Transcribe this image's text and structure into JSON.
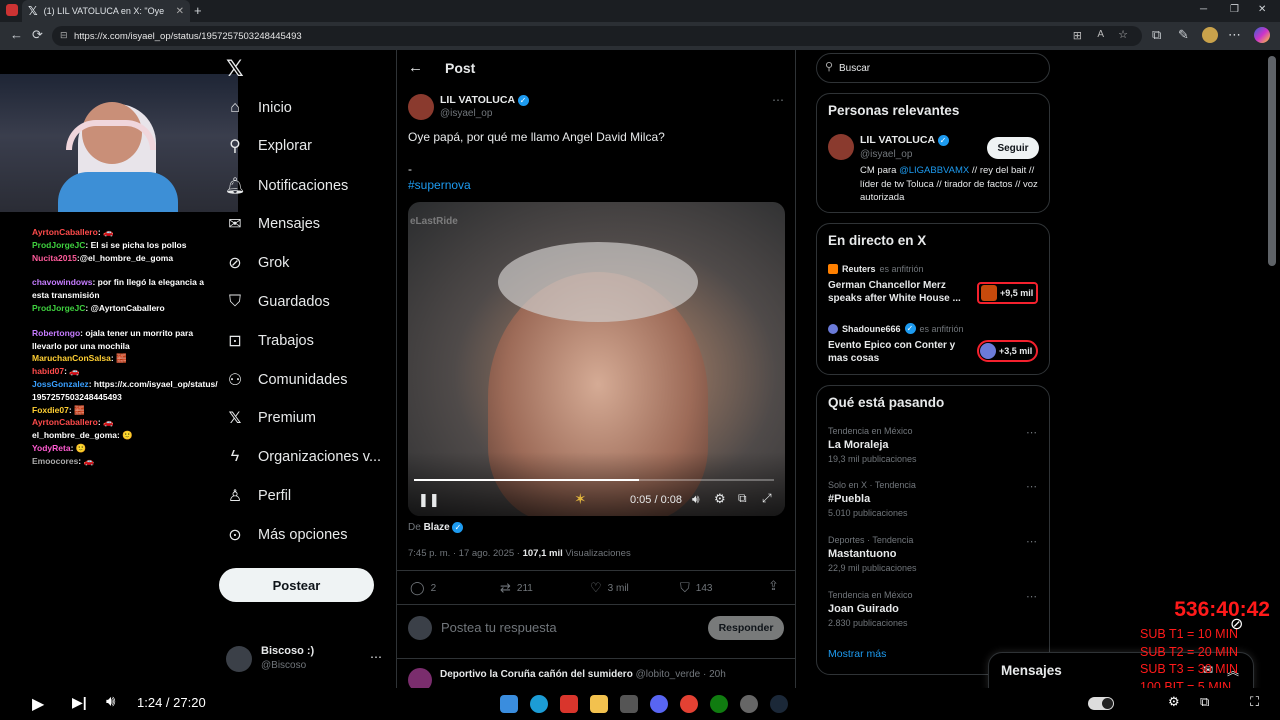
{
  "browser": {
    "tab_title": "(1) LIL VATOLUCA en X: \"Oye",
    "url": "https://x.com/isyael_op/status/1957257503248445493"
  },
  "nav": {
    "items": [
      {
        "label": "Inicio",
        "icon": "home-icon"
      },
      {
        "label": "Explorar",
        "icon": "search-icon"
      },
      {
        "label": "Notificaciones",
        "icon": "bell-icon"
      },
      {
        "label": "Mensajes",
        "icon": "mail-icon"
      },
      {
        "label": "Grok",
        "icon": "grok-icon"
      },
      {
        "label": "Guardados",
        "icon": "bookmark-icon"
      },
      {
        "label": "Trabajos",
        "icon": "briefcase-icon"
      },
      {
        "label": "Comunidades",
        "icon": "people-icon"
      },
      {
        "label": "Premium",
        "icon": "x-icon"
      },
      {
        "label": "Organizaciones v...",
        "icon": "lightning-icon"
      },
      {
        "label": "Perfil",
        "icon": "person-icon"
      },
      {
        "label": "Más opciones",
        "icon": "more-circle-icon"
      }
    ],
    "post_button": "Postear",
    "account_name": "Biscoso :)",
    "account_handle": "@Biscoso"
  },
  "post": {
    "header": "Post",
    "author_name": "LIL VATOLUCA",
    "author_handle": "@isyael_op",
    "text": "Oye papá, por qué me llamo Angel David Milca?",
    "text_line2": "-",
    "hashtag": "#supernova",
    "video_watermark": "eLastRide",
    "video_time": "0:05 / 0:08",
    "video_progress": 0.625,
    "source_prefix": "De",
    "source": "Blaze",
    "timestamp": "7:45 p. m. · 17 ago. 2025 · ",
    "views_count": "107,1 mil",
    "views_label": "Visualizaciones",
    "replies": "2",
    "reposts": "211",
    "likes": "3 mil",
    "bookmarks": "143",
    "reply_placeholder": "Postea tu respuesta",
    "reply_button": "Responder",
    "next_author": "Deportivo la Coruña cañón del sumidero",
    "next_handle": "@lobito_verde · 20h"
  },
  "search": {
    "placeholder": "Buscar"
  },
  "relevant": {
    "title": "Personas relevantes",
    "name": "LIL VATOLUCA",
    "handle": "@isyael_op",
    "follow": "Seguir",
    "bio_prefix": "CM para ",
    "bio_mention": "@LIGABBVAMX",
    "bio_rest": " // rey del bait // líder de tw Toluca // tirador de factos // voz autorizada"
  },
  "live": {
    "title": "En directo en X",
    "items": [
      {
        "host": "Reuters",
        "role": "es anfitrión",
        "title": "German Chancellor Merz speaks after White House ...",
        "count": "+9,5 mil"
      },
      {
        "host": "Shadoune666",
        "role": "es anfitrión",
        "title": "Evento Epico con Conter y mas cosas",
        "count": "+3,5 mil"
      }
    ]
  },
  "trends": {
    "title": "Qué está pasando",
    "items": [
      {
        "cat": "Tendencia en México",
        "name": "La Moraleja",
        "count": "19,3 mil publicaciones"
      },
      {
        "cat": "Solo en X · Tendencia",
        "name": "#Puebla",
        "count": "5.010 publicaciones"
      },
      {
        "cat": "Deportes · Tendencia",
        "name": "Mastantuono",
        "count": "22,9 mil publicaciones"
      },
      {
        "cat": "Tendencia en México",
        "name": "Joan Guirado",
        "count": "2.830 publicaciones"
      }
    ],
    "more": "Mostrar más"
  },
  "messages_drawer": "Mensajes",
  "stream": {
    "timer": "536:40:42",
    "subs": [
      "SUB T1 = 10 MIN",
      "SUB T2 = 20 MIN",
      "SUB T3 = 30 MIN",
      "100 BIT = 5 MIN"
    ],
    "chat": [
      {
        "user": "AyrtonCaballero",
        "color": "#ff4b4b",
        "msg": ""
      },
      {
        "user": "ProdJorgeJC",
        "color": "#3fd13f",
        "msg": "El si se picha los pollos"
      },
      {
        "user": "Nucita2015",
        "color": "#ff5b9b",
        "msg": "@el_hombre_de_goma"
      },
      {
        "user": "chavowindows",
        "color": "#c67cff",
        "msg": "por fin llegó la elegancia a esta transmisión"
      },
      {
        "user": "ProdJorgeJC",
        "color": "#3fd13f",
        "msg": "@AyrtonCaballero"
      },
      {
        "user": "Robertongo",
        "color": "#c67cff",
        "msg": "ojala tener un morrito para llevarlo por una mochila"
      },
      {
        "user": "MaruchanConSalsa",
        "color": "#ffcf33",
        "msg": ""
      },
      {
        "user": "habid07",
        "color": "#ff4b4b",
        "msg": ""
      },
      {
        "user": "JossGonzalez",
        "color": "#3aa0ff",
        "msg": "https://x.com/isyael_op/status/1957257503248445493"
      },
      {
        "user": "Foxdie07",
        "color": "#ffcf33",
        "msg": ""
      },
      {
        "user": "AyrtonCaballero",
        "color": "#ff4b4b",
        "msg": ""
      },
      {
        "user": "el_hombre_de_goma",
        "color": "#ffffff",
        "msg": ""
      },
      {
        "user": "YodyReta",
        "color": "#ff5bd1",
        "msg": ""
      },
      {
        "user": "Emoocores",
        "color": "#aaaaaa",
        "msg": ""
      }
    ]
  },
  "player": {
    "time": "1:24 / 27:20"
  },
  "colors": {
    "accent": "#1d9bf0",
    "live_border": "#f4212e"
  }
}
